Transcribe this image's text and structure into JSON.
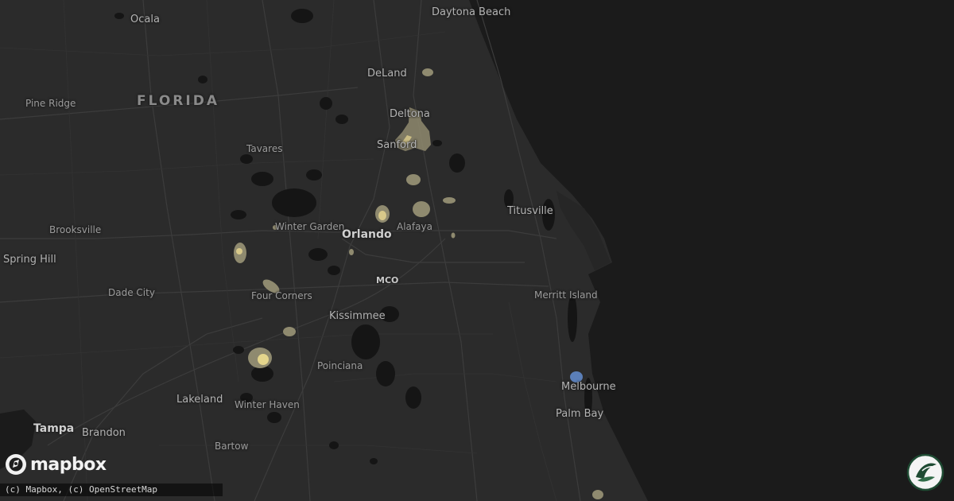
{
  "map": {
    "state_label": "FLORIDA",
    "places": [
      {
        "id": "daytona-beach",
        "name": "Daytona Beach",
        "kind": "city"
      },
      {
        "id": "ocala",
        "name": "Ocala",
        "kind": "city"
      },
      {
        "id": "deland",
        "name": "DeLand",
        "kind": "city"
      },
      {
        "id": "pine-ridge",
        "name": "Pine Ridge",
        "kind": "town"
      },
      {
        "id": "deltona",
        "name": "Deltona",
        "kind": "city"
      },
      {
        "id": "sanford",
        "name": "Sanford",
        "kind": "city"
      },
      {
        "id": "tavares",
        "name": "Tavares",
        "kind": "town"
      },
      {
        "id": "titusville",
        "name": "Titusville",
        "kind": "city"
      },
      {
        "id": "winter-garden",
        "name": "Winter Garden",
        "kind": "town"
      },
      {
        "id": "orlando",
        "name": "Orlando",
        "kind": "major"
      },
      {
        "id": "alafaya",
        "name": "Alafaya",
        "kind": "town"
      },
      {
        "id": "brooksville",
        "name": "Brooksville",
        "kind": "town"
      },
      {
        "id": "spring-hill",
        "name": "Spring Hill",
        "kind": "city"
      },
      {
        "id": "mco",
        "name": "MCO",
        "kind": "airport"
      },
      {
        "id": "dade-city",
        "name": "Dade City",
        "kind": "town"
      },
      {
        "id": "four-corners",
        "name": "Four Corners",
        "kind": "town"
      },
      {
        "id": "merritt-island",
        "name": "Merritt Island",
        "kind": "town"
      },
      {
        "id": "kissimmee",
        "name": "Kissimmee",
        "kind": "city"
      },
      {
        "id": "poinciana",
        "name": "Poinciana",
        "kind": "town"
      },
      {
        "id": "melbourne",
        "name": "Melbourne",
        "kind": "city"
      },
      {
        "id": "lakeland",
        "name": "Lakeland",
        "kind": "city"
      },
      {
        "id": "winter-haven",
        "name": "Winter Haven",
        "kind": "town"
      },
      {
        "id": "palm-bay",
        "name": "Palm Bay",
        "kind": "city"
      },
      {
        "id": "tampa",
        "name": "Tampa",
        "kind": "major"
      },
      {
        "id": "brandon",
        "name": "Brandon",
        "kind": "city"
      },
      {
        "id": "bartow",
        "name": "Bartow",
        "kind": "town"
      }
    ],
    "hail_overlay_colors": {
      "light": "#8f8a6f",
      "medium": "#d8c98a",
      "core": "#f2e6a0",
      "cold": "#5b7fb8"
    }
  },
  "branding": {
    "logo_text": "mapbox",
    "attribution": "(c) Mapbox, (c) OpenStreetMap",
    "badge_icon": "leaf-swoosh-icon"
  },
  "colors": {
    "land": "#2b2b2b",
    "water": "#1b1b1b",
    "lakes": "#141414",
    "roads": "#3a3a3a"
  }
}
